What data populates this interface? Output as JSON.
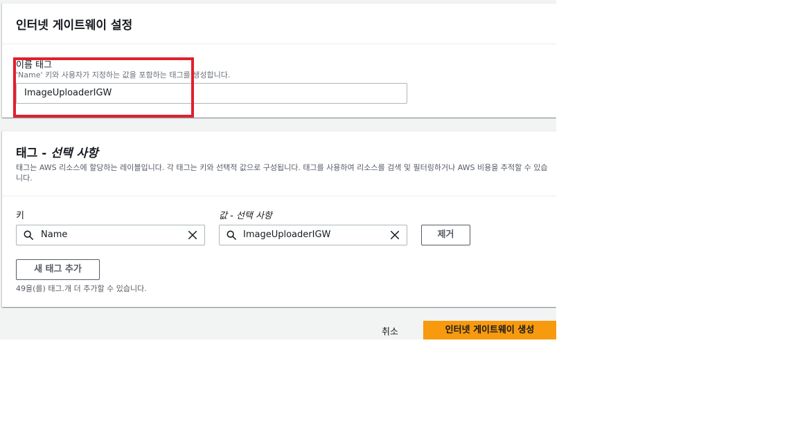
{
  "igw_settings": {
    "title": "인터넷 게이트웨이 설정",
    "name_tag": {
      "label": "이름 태그",
      "hint": "'Name' 키와 사용자가 지정하는 값을 포함하는 태그를 생성합니다.",
      "value": "ImageUploaderIGW"
    }
  },
  "tags": {
    "title_main": "태그 - ",
    "title_optional": "선택 사항",
    "description": "태그는 AWS 리소스에 할당하는 레이블입니다. 각 태그는 키와 선택적 값으로 구성됩니다. 태그를 사용하여 리소스를 검색 및 필터링하거나 AWS 비용을 추적할 수 있습니다.",
    "key_label": "키",
    "value_label": "값 - 선택 사항",
    "rows": [
      {
        "key": "Name",
        "value": "ImageUploaderIGW",
        "remove_label": "제거"
      }
    ],
    "add_tag_label": "새 태그 추가",
    "remaining_note": "49을(를) 태그.개 더 추가할 수 있습니다."
  },
  "footer": {
    "cancel_label": "취소",
    "create_label": "인터넷 게이트웨이 생성"
  },
  "colors": {
    "primary_button": "#f79a0e",
    "highlight": "#e0202c"
  },
  "icons": [
    "search-icon",
    "close-icon"
  ]
}
